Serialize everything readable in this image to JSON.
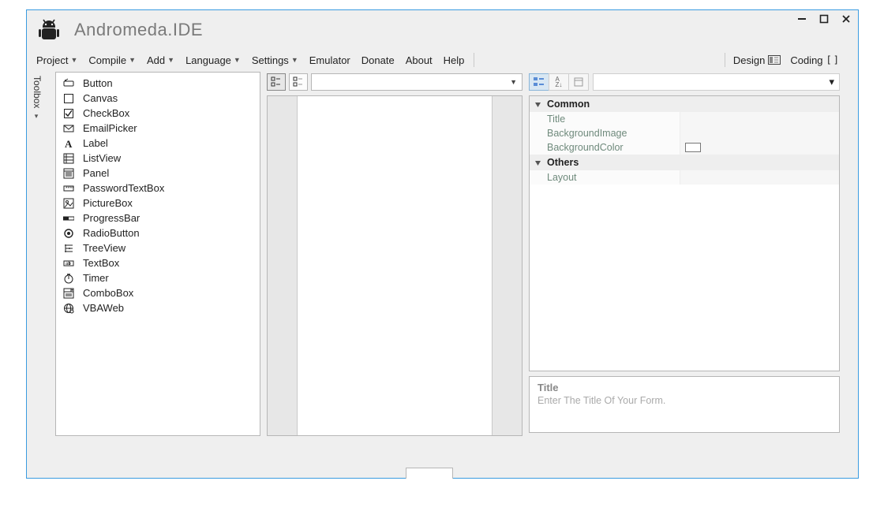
{
  "app": {
    "title": "Andromeda.IDE"
  },
  "window_controls": {
    "min": "—",
    "max": "▢",
    "close": "✕"
  },
  "menu": [
    {
      "label": "Project",
      "dropdown": true
    },
    {
      "label": "Compile",
      "dropdown": true
    },
    {
      "label": "Add",
      "dropdown": true
    },
    {
      "label": "Language",
      "dropdown": true
    },
    {
      "label": "Settings",
      "dropdown": true
    },
    {
      "label": "Emulator",
      "dropdown": false
    },
    {
      "label": "Donate",
      "dropdown": false
    },
    {
      "label": "About",
      "dropdown": false
    },
    {
      "label": "Help",
      "dropdown": false
    }
  ],
  "modes": {
    "design": "Design",
    "coding": "Coding"
  },
  "toolbox": {
    "tab_label": "Toolbox",
    "items": [
      {
        "name": "Button",
        "icon": "button-icon"
      },
      {
        "name": "Canvas",
        "icon": "canvas-icon"
      },
      {
        "name": "CheckBox",
        "icon": "checkbox-icon"
      },
      {
        "name": "EmailPicker",
        "icon": "emailpicker-icon"
      },
      {
        "name": "Label",
        "icon": "label-icon"
      },
      {
        "name": "ListView",
        "icon": "listview-icon"
      },
      {
        "name": "Panel",
        "icon": "panel-icon"
      },
      {
        "name": "PasswordTextBox",
        "icon": "passwordtextbox-icon"
      },
      {
        "name": "PictureBox",
        "icon": "picturebox-icon"
      },
      {
        "name": "ProgressBar",
        "icon": "progressbar-icon"
      },
      {
        "name": "RadioButton",
        "icon": "radiobutton-icon"
      },
      {
        "name": "TreeView",
        "icon": "treeview-icon"
      },
      {
        "name": "TextBox",
        "icon": "textbox-icon"
      },
      {
        "name": "Timer",
        "icon": "timer-icon"
      },
      {
        "name": "ComboBox",
        "icon": "combobox-icon"
      },
      {
        "name": "VBAWeb",
        "icon": "vbaweb-icon"
      }
    ]
  },
  "props": {
    "categories": [
      {
        "name": "Common",
        "rows": [
          {
            "key": "Title",
            "val": ""
          },
          {
            "key": "BackgroundImage",
            "val": ""
          },
          {
            "key": "BackgroundColor",
            "val": "",
            "type": "color"
          }
        ]
      },
      {
        "name": "Others",
        "rows": [
          {
            "key": "Layout",
            "val": ""
          }
        ]
      }
    ],
    "help": {
      "name": "Title",
      "desc": "Enter The Title Of Your Form."
    }
  }
}
